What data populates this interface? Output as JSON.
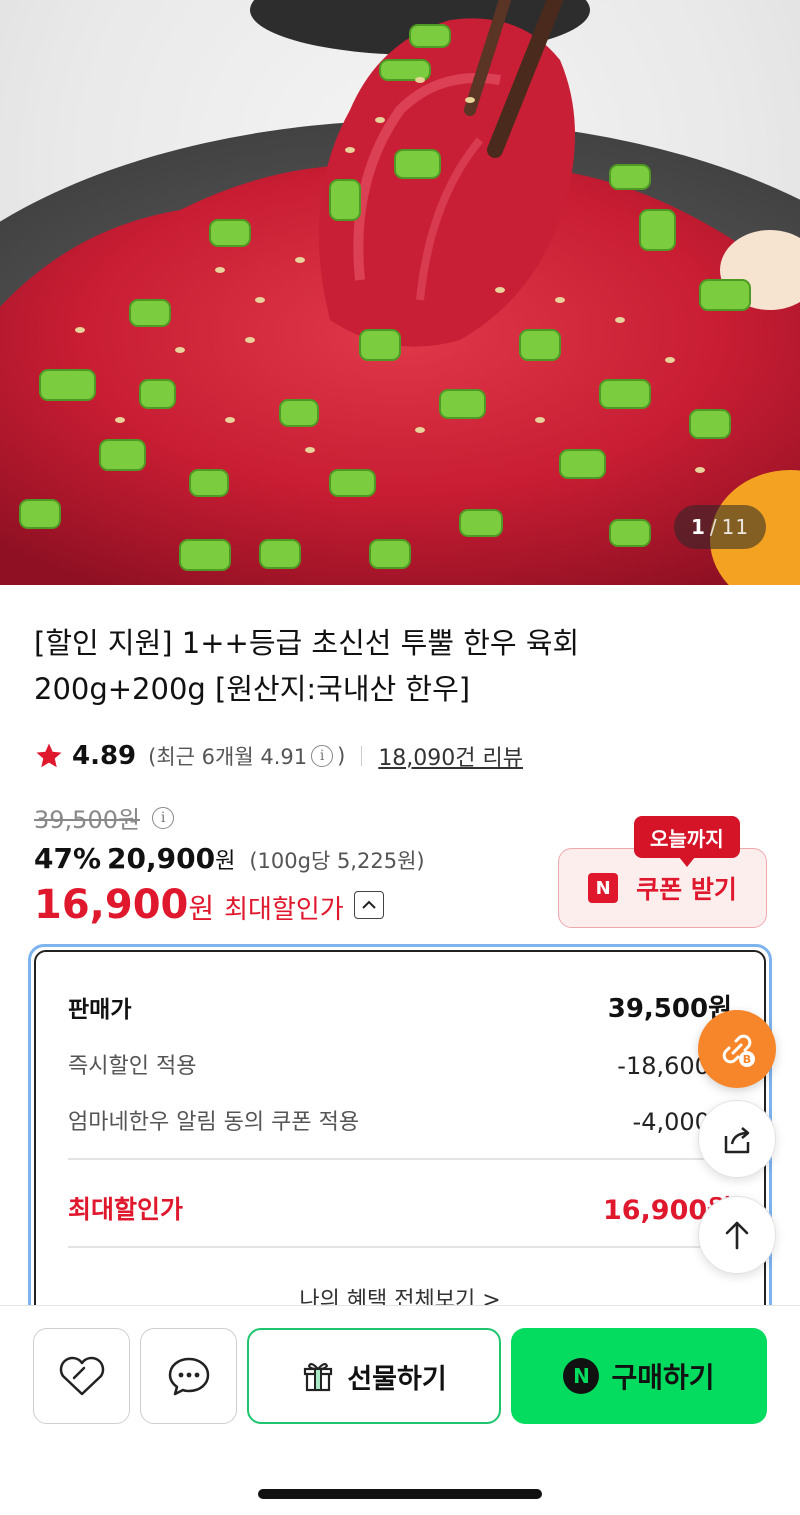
{
  "hero": {
    "image_alt": "",
    "pager_current": "1",
    "pager_sep": "/",
    "pager_total": "11"
  },
  "product": {
    "title_line1": "[할인 지원] 1++등급 초신선 투뿔 한우 육회",
    "title_line2": "200g+200g [원산지:국내산 한우]"
  },
  "rating": {
    "star_icon": "star-icon",
    "score": "4.89",
    "recent_prefix": "(최근 6개월 4.91",
    "recent_suffix": ")",
    "reviews": "18,090건 리뷰"
  },
  "price": {
    "original": "39,500원",
    "discount_pct": "47%",
    "discount_price": "20,900",
    "discount_unit": "원",
    "per_unit": "(100g당 5,225원)",
    "final_price": "16,900",
    "final_unit": "원",
    "final_label": "최대할인가"
  },
  "coupon": {
    "badge": "오늘까지",
    "logo": "N",
    "label": "쿠폰 받기"
  },
  "breakdown": {
    "sale_label": "판매가",
    "sale_value": "39,500원",
    "instant_label": "즉시할인 적용",
    "instant_value": "-18,600원",
    "alarm_label": "엄마네한우 알림 동의 쿠폰 적용",
    "alarm_value": "-4,000원",
    "max_label": "최대할인가",
    "max_value": "16,900원",
    "benefit_link": "나의 혜택 전체보기 >"
  },
  "fabs": {
    "link_icon": "link-icon",
    "share_icon": "share-icon",
    "top_icon": "arrow-up-icon"
  },
  "bottom_bar": {
    "gift_label": "선물하기",
    "buy_logo": "N",
    "buy_label": "구매하기"
  },
  "colors": {
    "accent_red": "#e0182d",
    "naver_green": "#03dc5e",
    "orange": "#f7862a",
    "box_outline": "#7db3ee"
  }
}
